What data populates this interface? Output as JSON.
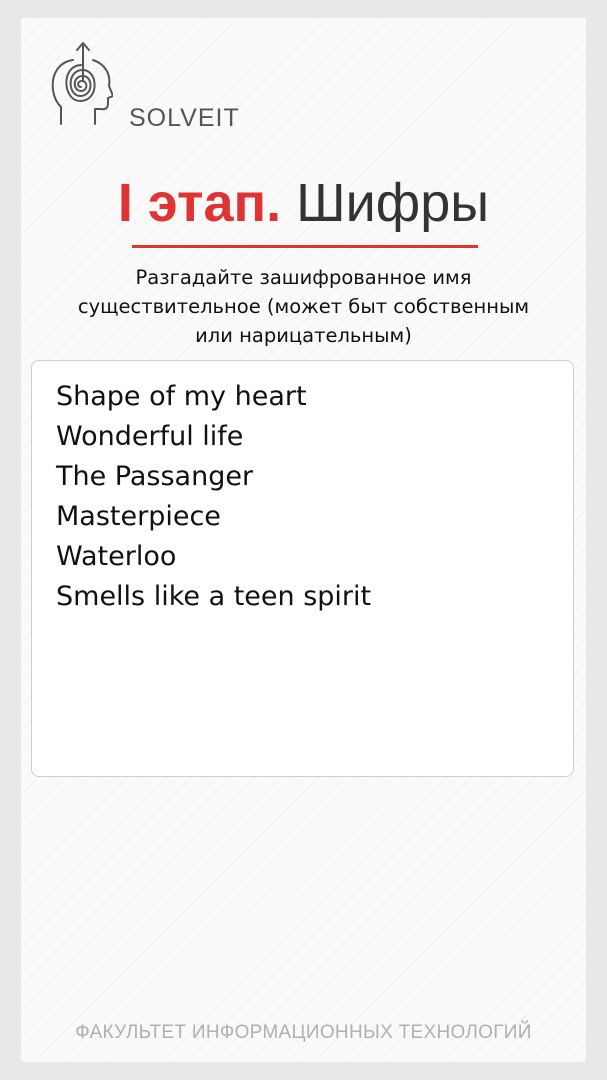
{
  "brand": {
    "name": "SOLVEIT",
    "logo_icon": "head-labyrinth-icon"
  },
  "title": {
    "accent": "I этап.",
    "main": "Шифры",
    "accent_color": "#e03434",
    "main_color": "#333333"
  },
  "instructions": {
    "lines": [
      "Разгадайте зашифрованное имя",
      "существительное (может быт собственным",
      "или нарицательным)"
    ]
  },
  "puzzle": {
    "lines": [
      "Shape of my heart",
      "Wonderful life",
      "The Passanger",
      "Masterpiece",
      "Waterloo",
      "Smells like a teen spirit"
    ]
  },
  "footer": {
    "text": "ФАКУЛЬТЕТ ИНФОРМАЦИОННЫХ ТЕХНОЛОГИЙ"
  }
}
